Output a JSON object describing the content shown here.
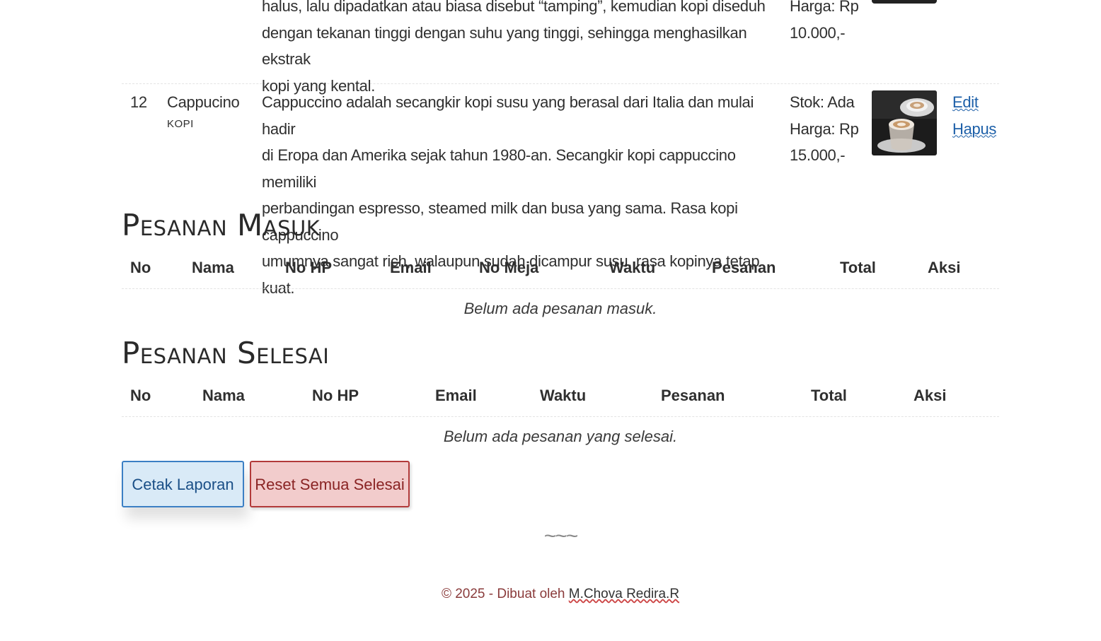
{
  "menu": {
    "rows": [
      {
        "no": "",
        "name": "",
        "category": "",
        "description_lines": [
          "halus, lalu dipadatkan atau biasa disebut “tamping”, kemudian kopi diseduh",
          "dengan tekanan tinggi dengan suhu yang tinggi, sehingga menghasilkan ekstrak",
          "kopi yang kental."
        ],
        "info_lines": [
          "Harga: Rp",
          "10.000,-"
        ]
      },
      {
        "no": "12",
        "name": "Cappucino",
        "category": "KOPI",
        "description_lines": [
          "Cappuccino adalah secangkir kopi susu yang berasal dari Italia dan mulai hadir",
          "di Eropa dan Amerika sejak tahun 1980-an. Secangkir kopi cappuccino memiliki",
          "perbandingan espresso, steamed milk dan busa yang sama. Rasa kopi cappuccino",
          "umumnya sangat rich, walaupun sudah dicampur susu, rasa kopinya tetap kuat."
        ],
        "info_lines": [
          "Stok: Ada",
          "Harga: Rp",
          "15.000,-"
        ],
        "edit_label": "Edit",
        "delete_label": "Hapus"
      }
    ]
  },
  "incoming": {
    "title": "Pesanan Masuk",
    "headers": [
      "No",
      "Nama",
      "No HP",
      "Email",
      "No Meja",
      "Waktu",
      "Pesanan",
      "Total",
      "Aksi"
    ],
    "empty_text": "Belum ada pesanan masuk."
  },
  "completed": {
    "title": "Pesanan Selesai",
    "headers": [
      "No",
      "Nama",
      "No HP",
      "Email",
      "Waktu",
      "Pesanan",
      "Total",
      "Aksi"
    ],
    "empty_text": "Belum ada pesanan yang selesai."
  },
  "actions": {
    "print_label": "Cetak Laporan",
    "reset_label": "Reset Semua Selesai"
  },
  "divider": "~~~",
  "footer": {
    "prefix": "© 2025 - Dibuat oleh ",
    "author": "M.Chova Redira.R"
  },
  "colors": {
    "link": "#1c5fa8",
    "print_bg": "#d9eaf7",
    "reset_bg": "#f2cccc",
    "footer_text": "#8a3b3b"
  }
}
